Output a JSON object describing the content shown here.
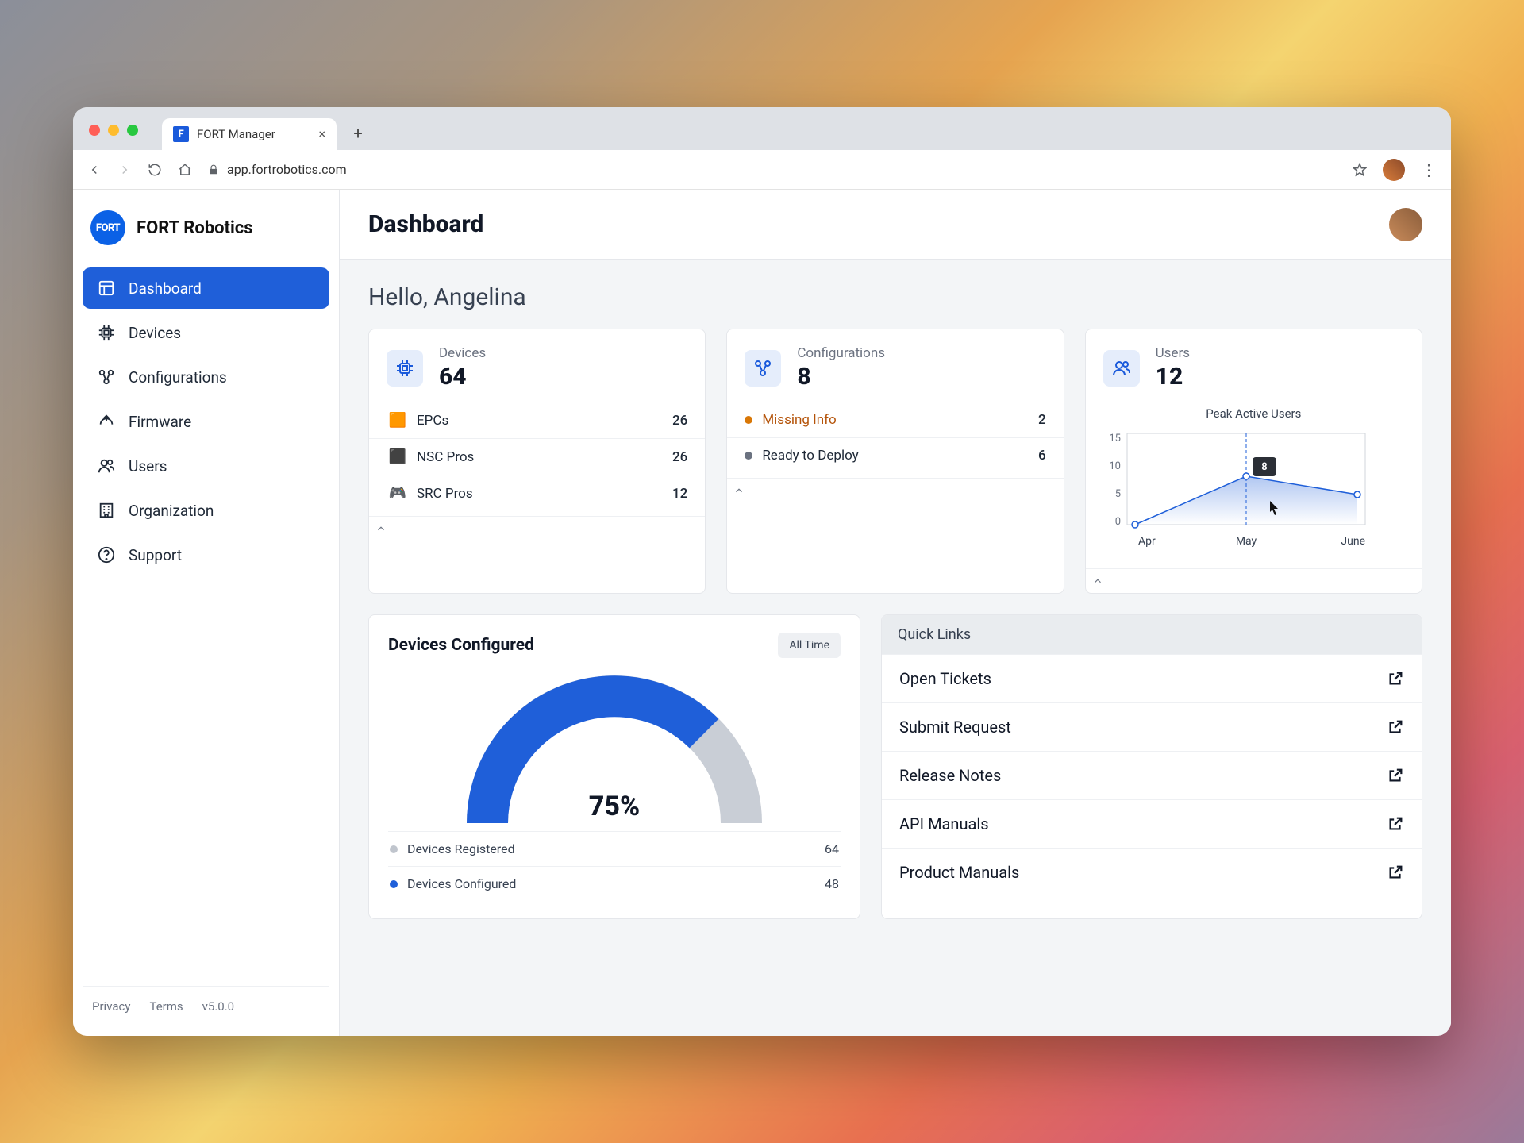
{
  "browser": {
    "tab_title": "FORT Manager",
    "url": "app.fortrobotics.com"
  },
  "brand": {
    "logo_text": "FORT",
    "name": "FORT Robotics"
  },
  "sidebar": {
    "items": [
      {
        "label": "Dashboard",
        "icon": "dashboard-icon",
        "active": true
      },
      {
        "label": "Devices",
        "icon": "chip-icon"
      },
      {
        "label": "Configurations",
        "icon": "config-icon"
      },
      {
        "label": "Firmware",
        "icon": "firmware-icon"
      },
      {
        "label": "Users",
        "icon": "users-icon"
      },
      {
        "label": "Organization",
        "icon": "organization-icon"
      },
      {
        "label": "Support",
        "icon": "support-icon"
      }
    ],
    "footer": {
      "privacy": "Privacy",
      "terms": "Terms",
      "version": "v5.0.0"
    }
  },
  "page_title": "Dashboard",
  "greeting": "Hello, Angelina",
  "cards": {
    "devices": {
      "title": "Devices",
      "count": "64",
      "rows": [
        {
          "emoji": "🟧",
          "label": "EPCs",
          "value": "26"
        },
        {
          "emoji": "⬛",
          "label": "NSC Pros",
          "value": "26"
        },
        {
          "emoji": "🎮",
          "label": "SRC Pros",
          "value": "12"
        }
      ]
    },
    "configurations": {
      "title": "Configurations",
      "count": "8",
      "rows": [
        {
          "color": "#d97706",
          "label": "Missing Info",
          "value": "2"
        },
        {
          "color": "#6b7280",
          "label": "Ready to Deploy",
          "value": "6"
        }
      ]
    },
    "users": {
      "title": "Users",
      "count": "12",
      "chart_title": "Peak Active Users",
      "tooltip_value": "8"
    }
  },
  "devices_configured": {
    "title": "Devices Configured",
    "filter": "All Time",
    "percent": "75%",
    "legend": [
      {
        "color": "#c0c5cd",
        "label": "Devices Registered",
        "value": "64"
      },
      {
        "color": "#1f5fd9",
        "label": "Devices Configured",
        "value": "48"
      }
    ]
  },
  "quicklinks": {
    "title": "Quick Links",
    "items": [
      {
        "label": "Open Tickets"
      },
      {
        "label": "Submit Request"
      },
      {
        "label": "Release Notes"
      },
      {
        "label": "API Manuals"
      },
      {
        "label": "Product Manuals"
      }
    ]
  },
  "chart_data": {
    "type": "line",
    "title": "Peak Active Users",
    "categories": [
      "Apr",
      "May",
      "June"
    ],
    "values": [
      0,
      8,
      5
    ],
    "ylim": [
      0,
      15
    ],
    "yticks": [
      0,
      5,
      10,
      15
    ],
    "highlight": {
      "category": "May",
      "value": 8
    }
  }
}
